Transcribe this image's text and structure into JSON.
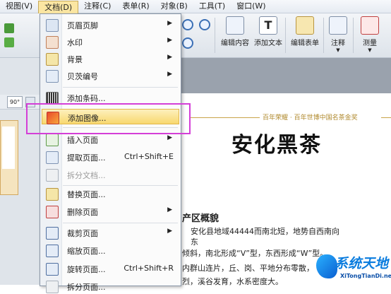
{
  "menubar": [
    "视图(V)",
    "文档(D)",
    "注释(C)",
    "表单(R)",
    "对象(B)",
    "工具(T)",
    "窗口(W)"
  ],
  "toolbar": {
    "edit_content": "编辑内容",
    "add_text": "添加文本",
    "edit_form": "编辑表单",
    "annotate": "注释",
    "measure": "测量",
    "rotate": "90°"
  },
  "menu": {
    "items": [
      {
        "label": "页眉页脚",
        "shortcut": "",
        "submenu": true
      },
      {
        "label": "水印",
        "shortcut": "",
        "submenu": true
      },
      {
        "label": "背景",
        "shortcut": "",
        "submenu": true
      },
      {
        "label": "贝茨编号",
        "shortcut": "",
        "submenu": true
      },
      {
        "label": "添加条码...",
        "shortcut": "",
        "submenu": false
      },
      {
        "label": "添加图像...",
        "shortcut": "",
        "submenu": false
      },
      {
        "label": "插入页面",
        "shortcut": "",
        "submenu": true
      },
      {
        "label": "提取页面...",
        "shortcut": "Ctrl+Shift+E",
        "submenu": false
      },
      {
        "label": "拆分文档...",
        "shortcut": "",
        "submenu": false
      },
      {
        "label": "替换页面...",
        "shortcut": "",
        "submenu": false
      },
      {
        "label": "删除页面",
        "shortcut": "",
        "submenu": true
      },
      {
        "label": "裁剪页面",
        "shortcut": "",
        "submenu": true
      },
      {
        "label": "缩放页面...",
        "shortcut": "",
        "submenu": false
      },
      {
        "label": "旋转页面...",
        "shortcut": "Ctrl+Shift+R",
        "submenu": false
      },
      {
        "label": "拆分页面...",
        "shortcut": "",
        "submenu": false
      }
    ]
  },
  "document": {
    "tagline": "百年荣耀 · 百年世博中国名茶金奖",
    "title": "安化黑茶",
    "heading": "产区概貌",
    "lines": [
      "安化县地域44444而南北短，地势自西南向",
      "东",
      "倾斜，南北形成“V”型，东西形成“W”型。",
      "内群山连片，丘、岗、平地分布零散，",
      "烈，溪谷发育，水系密度大。"
    ]
  },
  "watermark": {
    "title": "系统天地",
    "subtitle": "XiTongTianDi.net"
  },
  "colors": {
    "highlight_box": "#d43fd7",
    "menu_hover": "#f8d86f",
    "gold": "#c9a449"
  }
}
